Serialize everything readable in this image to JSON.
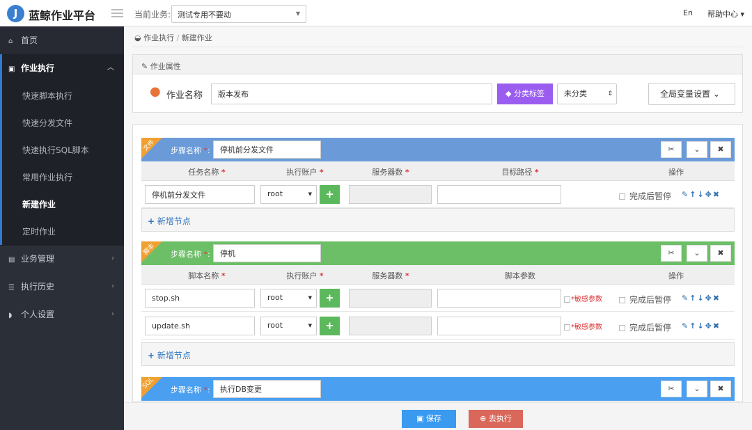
{
  "app": {
    "logo_letter": "J",
    "title": "蓝鲸作业平台"
  },
  "topbar": {
    "biz_label": "当前业务:",
    "biz_value": "测试专用不要动",
    "lang": "En",
    "help": "帮助中心 ▾"
  },
  "sidebar": {
    "items": [
      {
        "label": "首页",
        "icon": "home-icon"
      },
      {
        "label": "作业执行",
        "icon": "calendar-icon",
        "expanded": true,
        "children": [
          "快速脚本执行",
          "快速分发文件",
          "快速执行SQL脚本",
          "常用作业执行",
          "新建作业",
          "定时作业"
        ],
        "active_child": "新建作业"
      },
      {
        "label": "业务管理",
        "icon": "briefcase-icon"
      },
      {
        "label": "执行历史",
        "icon": "list-icon"
      },
      {
        "label": "个人设置",
        "icon": "shield-icon"
      }
    ]
  },
  "breadcrumb": [
    "作业执行",
    "新建作业"
  ],
  "job_props": {
    "title": "作业属性",
    "name_label": "作业名称",
    "name_value": "版本发布",
    "tag_label": "分类标签",
    "category": "未分类",
    "global_vars": "全局变量设置"
  },
  "colors": {
    "file": "#6a9bd8",
    "script": "#6cbf67",
    "sql": "#4a9ff0",
    "tag": "#9a5df0",
    "save": "#3a9af0",
    "exec": "#d9675a"
  },
  "steps": [
    {
      "type": "文件",
      "name_label": "步骤名称",
      "name": "停机前分发文件",
      "headers": [
        "任务名称",
        "执行账户",
        "服务器数",
        "目标路径",
        "操作"
      ],
      "rows": [
        {
          "name": "停机前分发文件",
          "account": "root",
          "servers": "",
          "path": "",
          "pause": "完成后暂停"
        }
      ],
      "add_node": "新增节点"
    },
    {
      "type": "脚本",
      "name_label": "步骤名称",
      "name": "停机",
      "headers": [
        "脚本名称",
        "执行账户",
        "服务器数",
        "脚本参数",
        "操作"
      ],
      "rows": [
        {
          "name": "stop.sh",
          "account": "root",
          "servers": "",
          "params": "",
          "sensitive": "敏感参数",
          "pause": "完成后暂停"
        },
        {
          "name": "update.sh",
          "account": "root",
          "servers": "",
          "params": "",
          "sensitive": "敏感参数",
          "pause": "完成后暂停"
        }
      ],
      "add_node": "新增节点"
    },
    {
      "type": "SQL",
      "name_label": "步骤名称",
      "name": "执行DB变更"
    }
  ],
  "footer": {
    "save": "保存",
    "execute": "去执行"
  }
}
